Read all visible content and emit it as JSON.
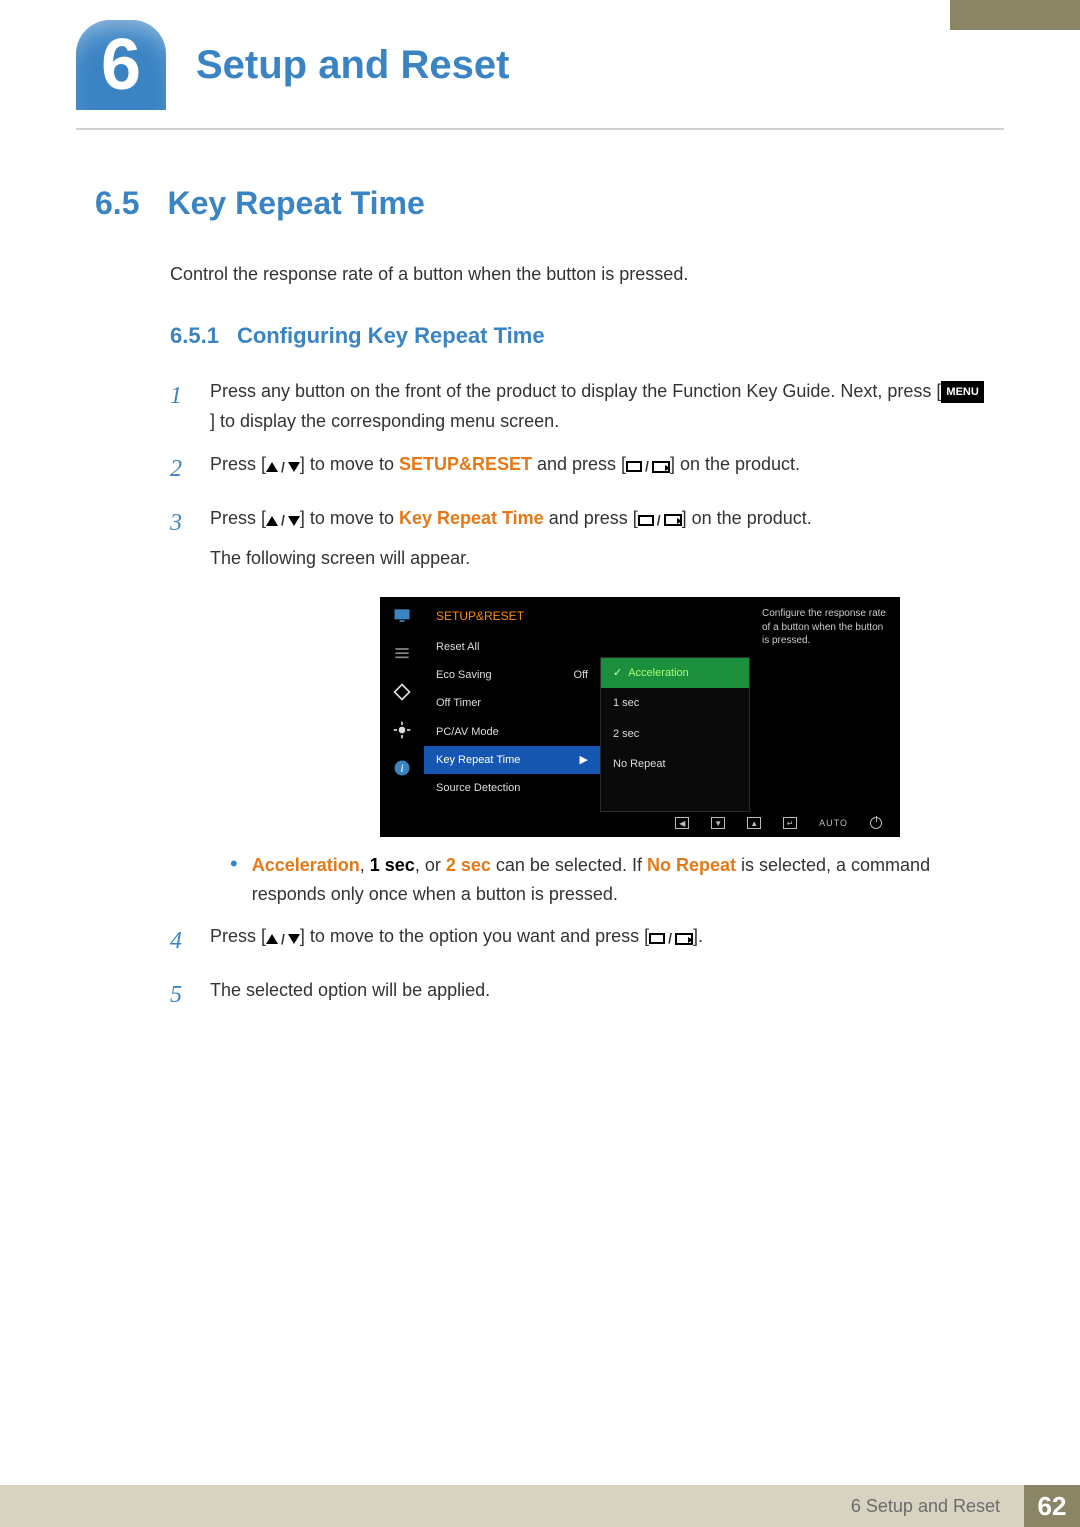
{
  "chapter": {
    "number": "6",
    "title": "Setup and Reset"
  },
  "section": {
    "number": "6.5",
    "title": "Key Repeat Time"
  },
  "intro": "Control the response rate of a button when the button is pressed.",
  "subsection": {
    "number": "6.5.1",
    "title": "Configuring Key Repeat Time"
  },
  "steps": {
    "s1_a": "Press any button on the front of the product to display the Function Key Guide. Next, press [",
    "s1_menu": "MENU",
    "s1_b": "] to display the corresponding menu screen.",
    "s2_a": "Press [",
    "s2_b": "] to move to ",
    "s2_target": "SETUP&RESET",
    "s2_c": " and press [",
    "s2_d": "] on the product.",
    "s3_a": "Press [",
    "s3_b": "] to move to ",
    "s3_target": "Key Repeat Time",
    "s3_c": " and press [",
    "s3_d": "] on the product.",
    "s3_follow": "The following screen will appear.",
    "s4_a": "Press [",
    "s4_b": "] to move to the option you want and press [",
    "s4_c": "].",
    "s5": "The selected option will be applied."
  },
  "bullet": {
    "accel": "Acceleration",
    "sep1": ", ",
    "onesec": "1 sec",
    "sep2": ", or ",
    "twosec": "2 sec",
    "mid": " can be selected. If ",
    "norepeat": "No Repeat",
    "tail": " is selected, a command responds only once when a button is pressed."
  },
  "osd": {
    "title": "SETUP&RESET",
    "items": [
      {
        "label": "Reset All",
        "value": ""
      },
      {
        "label": "Eco Saving",
        "value": "Off"
      },
      {
        "label": "Off Timer",
        "value": ""
      },
      {
        "label": "PC/AV Mode",
        "value": ""
      },
      {
        "label": "Key Repeat Time",
        "value": "",
        "selected": true
      },
      {
        "label": "Source Detection",
        "value": ""
      }
    ],
    "sub": [
      {
        "label": "Acceleration",
        "selected": true
      },
      {
        "label": "1 sec"
      },
      {
        "label": "2 sec"
      },
      {
        "label": "No Repeat"
      }
    ],
    "help": "Configure the response rate of a button when the button is pressed.",
    "footer_auto": "AUTO"
  },
  "footer": {
    "label": "6 Setup and Reset",
    "page": "62"
  }
}
